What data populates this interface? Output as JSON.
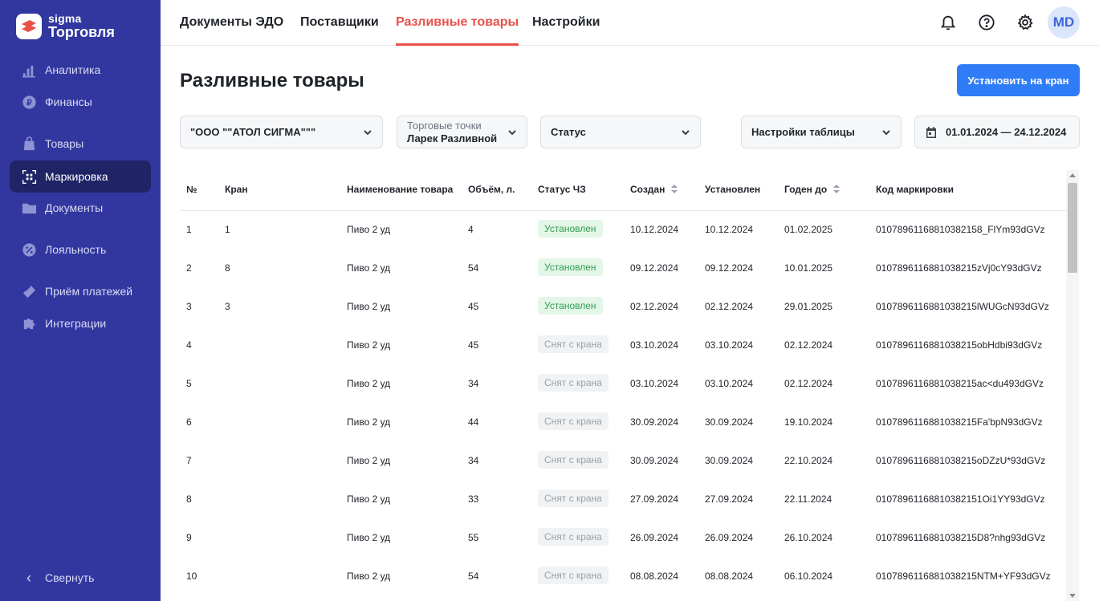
{
  "brand": {
    "top": "sigma",
    "bottom": "Торговля",
    "accent": "#e8504a"
  },
  "sidebar": {
    "items": [
      {
        "label": "Аналитика",
        "icon": "bar-chart-icon"
      },
      {
        "label": "Финансы",
        "icon": "ruble-coin-icon"
      },
      {
        "label": "Товары",
        "icon": "shopping-bag-icon"
      },
      {
        "label": "Маркировка",
        "icon": "datamatrix-scan-icon",
        "active": true
      },
      {
        "label": "Документы",
        "icon": "folder-icon"
      },
      {
        "label": "Лояльность",
        "icon": "discount-badge-icon"
      },
      {
        "label": "Приём платежей",
        "icon": "payment-card-icon"
      },
      {
        "label": "Интеграции",
        "icon": "puzzle-icon"
      }
    ],
    "collapse_label": "Свернуть"
  },
  "header": {
    "tabs": [
      {
        "label": "Документы ЭДО"
      },
      {
        "label": "Поставщики"
      },
      {
        "label": "Разливные товары",
        "active": true
      },
      {
        "label": "Настройки"
      }
    ],
    "icons": [
      "bell-icon",
      "help-icon",
      "gear-icon"
    ],
    "avatar": "MD"
  },
  "page": {
    "title": "Разливные товары",
    "primary_button": "Установить на кран"
  },
  "filters": {
    "organization": "\"ООО \"\"АТОЛ СИГМА\"\"\"",
    "points_label": "Торговые точки",
    "points_value": "Ларек Разливной",
    "status": "Статус",
    "table_settings": "Настройки таблицы",
    "date_range": "01.01.2024 — 24.12.2024"
  },
  "table": {
    "columns": [
      "№",
      "Кран",
      "Наименование товара",
      "Объём, л.",
      "Статус ЧЗ",
      "Создан",
      "Установлен",
      "Годен до",
      "Код маркировки"
    ],
    "rows": [
      {
        "n": "1",
        "tap": "1",
        "name": "Пиво 2 уд",
        "volume": "4",
        "status": "Установлен",
        "status_type": "on",
        "created": "10.12.2024",
        "installed": "10.12.2024",
        "expires": "01.02.2025",
        "code": "0107896116881038215 8_FlYm93dGVz"
      },
      {
        "n": "2",
        "tap": "8",
        "name": "Пиво 2 уд",
        "volume": "54",
        "status": "Установлен",
        "status_type": "on",
        "created": "09.12.2024",
        "installed": "09.12.2024",
        "expires": "10.01.2025",
        "code": "010789611688103821 5zVj0cY93dGVz"
      },
      {
        "n": "3",
        "tap": "3",
        "name": "Пиво 2 уд",
        "volume": "45",
        "status": "Установлен",
        "status_type": "on",
        "created": "02.12.2024",
        "installed": "02.12.2024",
        "expires": "29.01.2025",
        "code": "010789611688103821 5lWUGcN93dGVz"
      },
      {
        "n": "4",
        "tap": "",
        "name": "Пиво 2 уд",
        "volume": "45",
        "status": "Снят с крана",
        "status_type": "off",
        "created": "03.10.2024",
        "installed": "03.10.2024",
        "expires": "02.12.2024",
        "code": "010789611688103821 5obHdbi93dGVz"
      },
      {
        "n": "5",
        "tap": "",
        "name": "Пиво 2 уд",
        "volume": "34",
        "status": "Снят с крана",
        "status_type": "off",
        "created": "03.10.2024",
        "installed": "03.10.2024",
        "expires": "02.12.2024",
        "code": "010789611688103821 5ac<du493dGVz"
      },
      {
        "n": "6",
        "tap": "",
        "name": "Пиво 2 уд",
        "volume": "44",
        "status": "Снят с крана",
        "status_type": "off",
        "created": "30.09.2024",
        "installed": "30.09.2024",
        "expires": "19.10.2024",
        "code": "010789611688103821 5Fa'bpN93dGVz"
      },
      {
        "n": "7",
        "tap": "",
        "name": "Пиво 2 уд",
        "volume": "34",
        "status": "Снят с крана",
        "status_type": "off",
        "created": "30.09.2024",
        "installed": "30.09.2024",
        "expires": "22.10.2024",
        "code": "010789611688103821 5oDZzU*93dGVz"
      },
      {
        "n": "8",
        "tap": "",
        "name": "Пиво 2 уд",
        "volume": "33",
        "status": "Снят с крана",
        "status_type": "off",
        "created": "27.09.2024",
        "installed": "27.09.2024",
        "expires": "22.11.2024",
        "code": "010789611688103821 51Oi1YY93dGVz"
      },
      {
        "n": "9",
        "tap": "",
        "name": "Пиво 2 уд",
        "volume": "55",
        "status": "Снят с крана",
        "status_type": "off",
        "created": "26.09.2024",
        "installed": "26.09.2024",
        "expires": "26.10.2024",
        "code": "010789611688103821 5D8?nhg93dGVz"
      },
      {
        "n": "10",
        "tap": "",
        "name": "Пиво 2 уд",
        "volume": "54",
        "status": "Снят с крана",
        "status_type": "off",
        "created": "08.08.2024",
        "installed": "08.08.2024",
        "expires": "06.10.2024",
        "code": "010789611688103821 5NTM+YF93dGVz"
      }
    ]
  }
}
